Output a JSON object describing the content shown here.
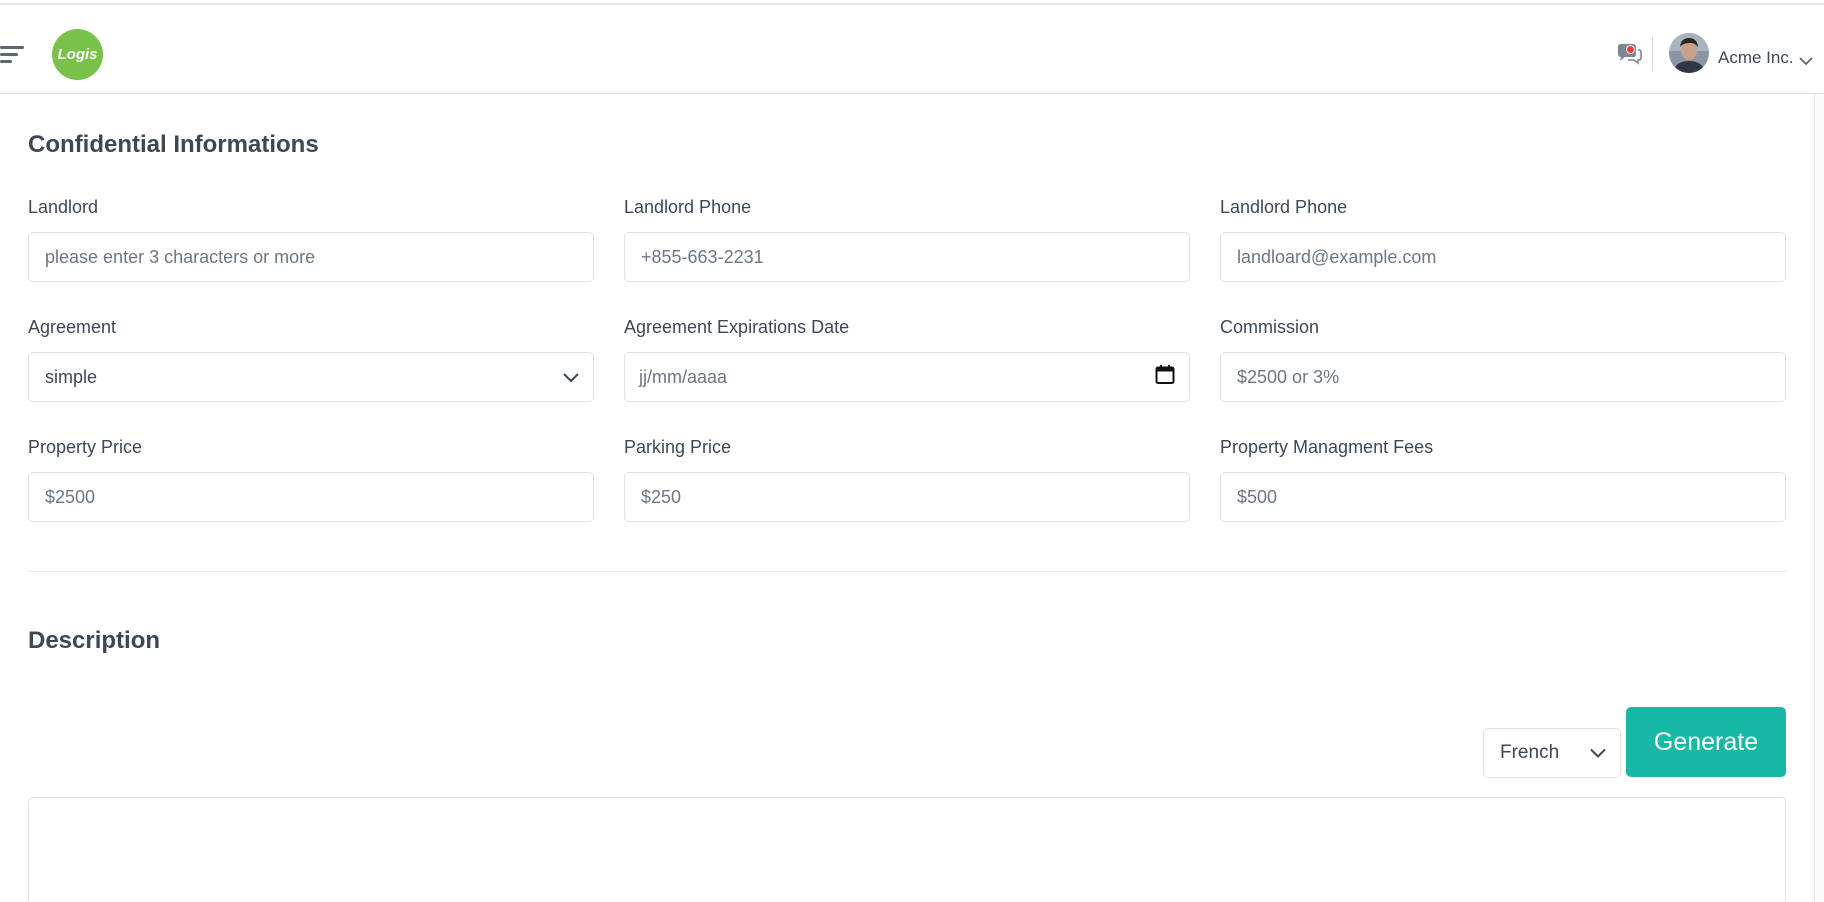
{
  "header": {
    "logo_text": "Logis",
    "company_name": "Acme Inc."
  },
  "confidential": {
    "title": "Confidential Informations",
    "fields": [
      {
        "label": "Landlord",
        "placeholder": "please enter 3 characters or more"
      },
      {
        "label": "Landlord Phone",
        "placeholder": "+855-663-2231"
      },
      {
        "label": "Landlord Phone",
        "placeholder": "landloard@example.com"
      },
      {
        "label": "Agreement",
        "value": "simple"
      },
      {
        "label": "Agreement Expirations Date",
        "placeholder": "jj/mm/aaaa"
      },
      {
        "label": "Commission",
        "placeholder": "$2500 or 3%"
      },
      {
        "label": "Property Price",
        "placeholder": "$2500"
      },
      {
        "label": "Parking Price",
        "placeholder": "$250"
      },
      {
        "label": "Property Managment Fees",
        "placeholder": "$500"
      }
    ]
  },
  "description": {
    "title": "Description",
    "language": "French",
    "generate_label": "Generate"
  },
  "colors": {
    "accent": "#17b8a6",
    "logo": "#78c24a",
    "notification": "#ef3b3b"
  }
}
